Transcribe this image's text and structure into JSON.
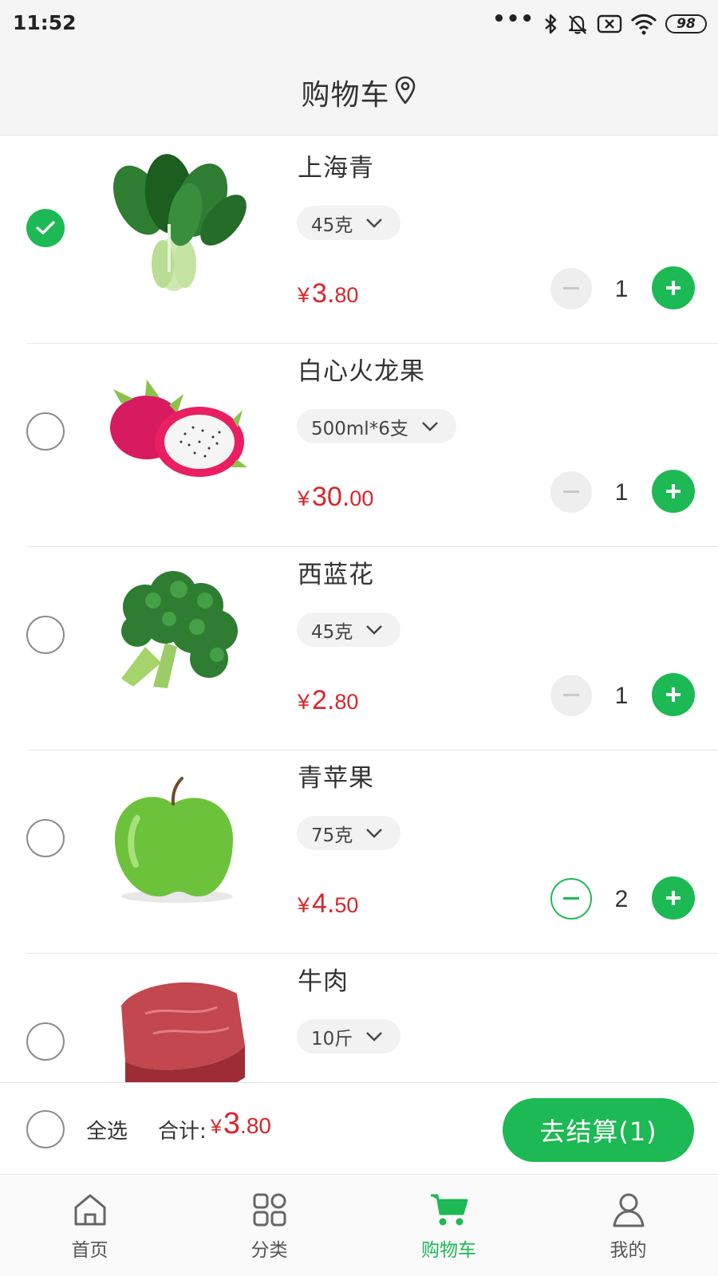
{
  "status_bar": {
    "time": "11:52",
    "battery": "98",
    "icons": [
      "more-dots-icon",
      "bluetooth-icon",
      "bell-off-icon",
      "no-sim-icon",
      "wifi-icon",
      "battery-icon"
    ]
  },
  "header": {
    "title": "购物车",
    "icon": "location-pin-icon"
  },
  "colors": {
    "accent": "#1db954",
    "price": "#d9262b",
    "background": "#f5f5f5"
  },
  "cart": {
    "items": [
      {
        "name": "上海青",
        "spec": "45克",
        "price_int": "3.",
        "price_dec": "80",
        "quantity": "1",
        "checked": true,
        "minus_enabled": false,
        "image": "bok-choy"
      },
      {
        "name": "白心火龙果",
        "spec": "500ml*6支",
        "price_int": "30.",
        "price_dec": "00",
        "quantity": "1",
        "checked": false,
        "minus_enabled": false,
        "image": "dragon-fruit"
      },
      {
        "name": "西蓝花",
        "spec": "45克",
        "price_int": "2.",
        "price_dec": "80",
        "quantity": "1",
        "checked": false,
        "minus_enabled": false,
        "image": "broccoli"
      },
      {
        "name": "青苹果",
        "spec": "75克",
        "price_int": "4.",
        "price_dec": "50",
        "quantity": "2",
        "checked": false,
        "minus_enabled": true,
        "image": "green-apple"
      },
      {
        "name": "牛肉",
        "spec": "10斤",
        "price_int": "",
        "price_dec": "",
        "quantity": "",
        "checked": false,
        "minus_enabled": false,
        "image": "beef"
      }
    ],
    "currency": "¥"
  },
  "footer": {
    "select_all_label": "全选",
    "total_label": "合计:",
    "total_currency": "¥",
    "total_int": "3",
    "total_dec": ".80",
    "checkout_label": "去结算(1)"
  },
  "tabbar": {
    "tabs": [
      {
        "label": "首页",
        "icon": "home-icon",
        "active": false
      },
      {
        "label": "分类",
        "icon": "category-grid-icon",
        "active": false
      },
      {
        "label": "购物车",
        "icon": "cart-icon",
        "active": true
      },
      {
        "label": "我的",
        "icon": "user-icon",
        "active": false
      }
    ]
  }
}
